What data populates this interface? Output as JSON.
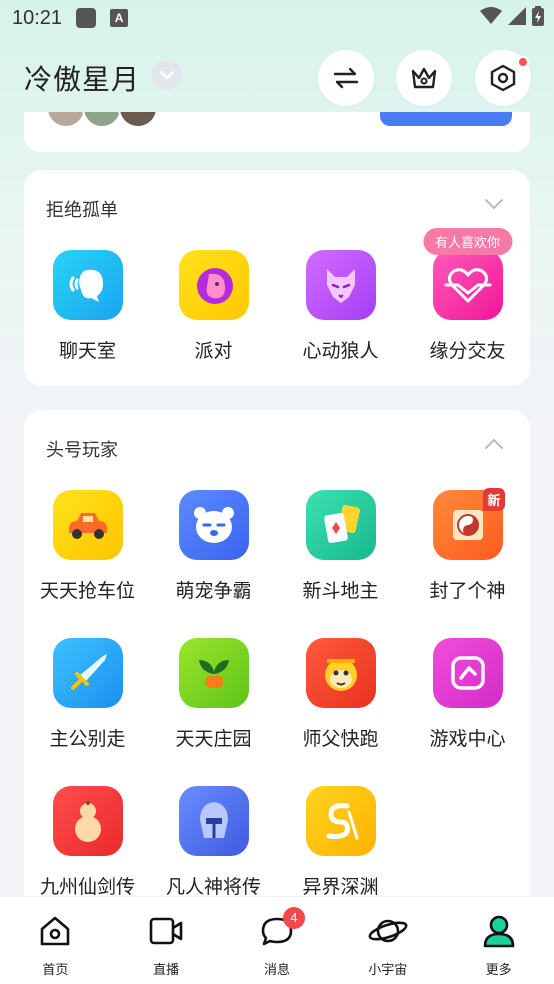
{
  "status_bar": {
    "time": "10:21"
  },
  "header": {
    "username": "冷傲星月"
  },
  "sections": [
    {
      "title": "拒绝孤单",
      "collapse_state": "collapsed",
      "apps": [
        {
          "label": "聊天室",
          "icon": "chat-room-icon"
        },
        {
          "label": "派对",
          "icon": "party-icon"
        },
        {
          "label": "心动狼人",
          "icon": "werewolf-icon"
        },
        {
          "label": "缘分交友",
          "icon": "dating-icon",
          "tag": "有人喜欢你"
        }
      ]
    },
    {
      "title": "头号玩家",
      "collapse_state": "expanded",
      "apps": [
        {
          "label": "天天抢车位",
          "icon": "car-parking-icon"
        },
        {
          "label": "萌宠争霸",
          "icon": "pet-battle-icon"
        },
        {
          "label": "新斗地主",
          "icon": "card-game-icon"
        },
        {
          "label": "封了个神",
          "icon": "taiji-icon",
          "badge": "新"
        },
        {
          "label": "主公别走",
          "icon": "sword-icon"
        },
        {
          "label": "天天庄园",
          "icon": "farm-icon"
        },
        {
          "label": "师父快跑",
          "icon": "monkey-icon"
        },
        {
          "label": "游戏中心",
          "icon": "game-center-icon"
        },
        {
          "label": "九州仙剑传",
          "icon": "gourd-icon"
        },
        {
          "label": "凡人神将传",
          "icon": "knight-helmet-icon"
        },
        {
          "label": "异界深渊",
          "icon": "abyss-icon"
        }
      ]
    }
  ],
  "bottom_nav": [
    {
      "label": "首页",
      "icon": "home-icon"
    },
    {
      "label": "直播",
      "icon": "video-camera-icon"
    },
    {
      "label": "消息",
      "icon": "message-icon",
      "badge": "4"
    },
    {
      "label": "小宇宙",
      "icon": "planet-icon"
    },
    {
      "label": "更多",
      "icon": "profile-icon",
      "active": true
    }
  ],
  "colors": {
    "accent": "#4b7cf3",
    "badge_red": "#f04a4a",
    "active_tab": "#1ad19b",
    "tag_pink": "#f57aa6"
  }
}
